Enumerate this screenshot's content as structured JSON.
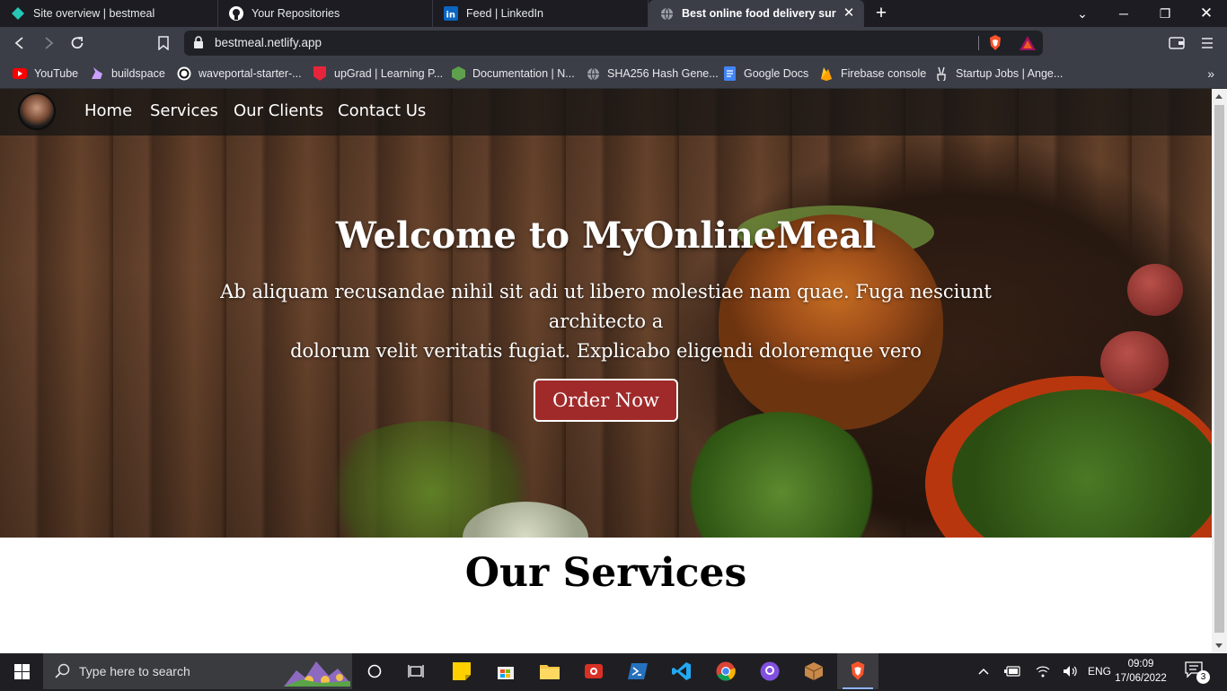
{
  "browser": {
    "tabs": [
      {
        "title": "Site overview | bestmeal",
        "icon": "netlify-icon"
      },
      {
        "title": "Your Repositories",
        "icon": "github-icon"
      },
      {
        "title": "Feed | LinkedIn",
        "icon": "linkedin-icon"
      },
      {
        "title": "Best online food delivery survice",
        "icon": "globe-icon",
        "active": true
      }
    ],
    "url": "bestmeal.netlify.app",
    "bookmarks": [
      {
        "label": "YouTube",
        "icon": "youtube-icon"
      },
      {
        "label": "buildspace",
        "icon": "unicorn-icon"
      },
      {
        "label": "waveportal-starter-...",
        "icon": "replit-icon"
      },
      {
        "label": "upGrad | Learning P...",
        "icon": "upgrad-icon"
      },
      {
        "label": "Documentation | N...",
        "icon": "nodejs-icon"
      },
      {
        "label": "SHA256 Hash Gene...",
        "icon": "globe-icon"
      },
      {
        "label": "Google Docs",
        "icon": "docs-icon"
      },
      {
        "label": "Firebase console",
        "icon": "firebase-icon"
      },
      {
        "label": "Startup Jobs | Ange...",
        "icon": "angellist-icon"
      }
    ]
  },
  "site": {
    "nav": [
      "Home",
      "Services",
      "Our Clients",
      "Contact Us"
    ],
    "hero": {
      "title": "Welcome to MyOnlineMeal",
      "subtitle_line1": "Ab aliquam recusandae nihil sit adi ut libero molestiae nam quae. Fuga nesciunt architecto a",
      "subtitle_line2": "dolorum velit veritatis fugiat. Explicabo eligendi doloremque vero",
      "cta": "Order Now"
    },
    "services_title": "Our Services"
  },
  "taskbar": {
    "search_placeholder": "Type here to search",
    "language": "ENG",
    "time": "09:09",
    "date": "17/06/2022",
    "notifications": "3"
  },
  "colors": {
    "cta_bg": "#a02a2a",
    "nav_bg": "rgba(20,20,20,0.72)",
    "browser_chrome": "#3b3d47"
  }
}
